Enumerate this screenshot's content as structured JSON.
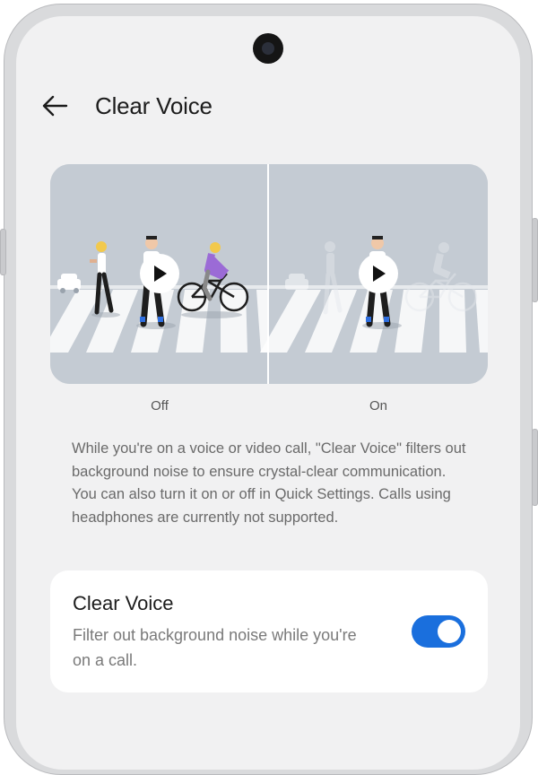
{
  "header": {
    "back_icon": "arrow-left-icon",
    "title": "Clear Voice"
  },
  "preview": {
    "left_label": "Off",
    "right_label": "On",
    "play_icon": "play-icon"
  },
  "description": "While you're on a voice or video call, \"Clear Voice\" filters out background noise to ensure crystal-clear communication. You can also turn it on or off in Quick Settings. Calls using headphones are currently not supported.",
  "setting": {
    "title": "Clear Voice",
    "subtitle": "Filter out background noise while you're on a call.",
    "enabled": true,
    "accent_color": "#1a6fdd"
  }
}
